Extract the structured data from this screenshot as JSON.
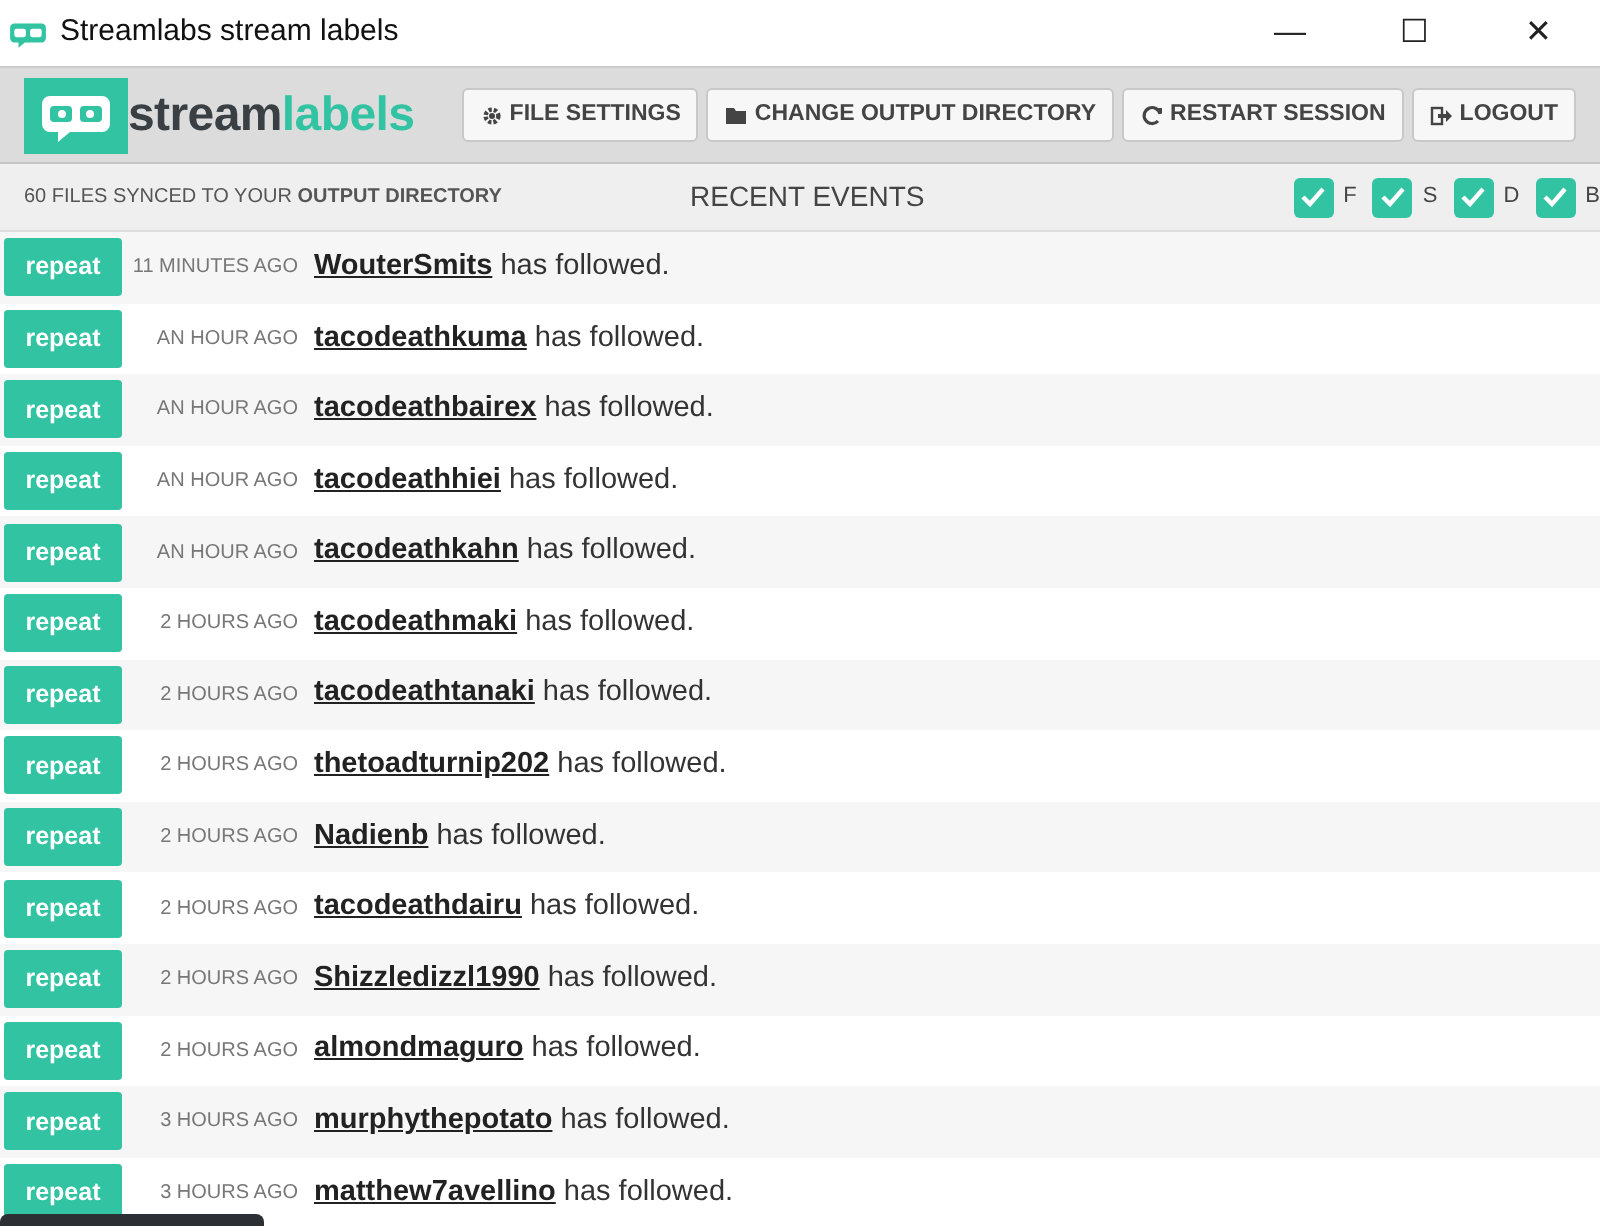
{
  "window": {
    "title": "Streamlabs stream labels",
    "controls": [
      "—",
      "☐",
      "✕"
    ]
  },
  "logo": {
    "part_1": "stream",
    "part_2": "labels"
  },
  "toolbar": [
    {
      "kind": "gear",
      "label": "FILE SETTINGS"
    },
    {
      "kind": "folder",
      "label": "CHANGE OUTPUT DIRECTORY"
    },
    {
      "kind": "refresh",
      "label": "RESTART SESSION"
    },
    {
      "kind": "logout",
      "label": "LOGOUT"
    }
  ],
  "sync_status": "60 FILES SYNCED TO YOUR **OUTPUT DIRECTORY**",
  "section_title": "RECENT EVENTS",
  "filters": [
    {
      "label": "F",
      "checked": true
    },
    {
      "label": "S",
      "checked": true
    },
    {
      "label": "D",
      "checked": true
    },
    {
      "label": "B",
      "checked": true
    }
  ],
  "events": [
    {
      "button": "repeat",
      "time": "11 MINUTES AGO",
      "user": "WouterSmits",
      "action": "has followed."
    },
    {
      "button": "repeat",
      "time": "AN HOUR AGO",
      "user": "tacodeathkuma",
      "action": "has followed."
    },
    {
      "button": "repeat",
      "time": "AN HOUR AGO",
      "user": "tacodeathbairex",
      "action": "has followed."
    },
    {
      "button": "repeat",
      "time": "AN HOUR AGO",
      "user": "tacodeathhiei",
      "action": "has followed."
    },
    {
      "button": "repeat",
      "time": "AN HOUR AGO",
      "user": "tacodeathkahn",
      "action": "has followed."
    },
    {
      "button": "repeat",
      "time": "2 HOURS AGO",
      "user": "tacodeathmaki",
      "action": "has followed."
    },
    {
      "button": "repeat",
      "time": "2 HOURS AGO",
      "user": "tacodeathtanaki",
      "action": "has followed."
    },
    {
      "button": "repeat",
      "time": "2 HOURS AGO",
      "user": "thetoadturnip202",
      "action": "has followed."
    },
    {
      "button": "repeat",
      "time": "2 HOURS AGO",
      "user": "Nadienb",
      "action": "has followed."
    },
    {
      "button": "repeat",
      "time": "2 HOURS AGO",
      "user": "tacodeathdairu",
      "action": "has followed."
    },
    {
      "button": "repeat",
      "time": "2 HOURS AGO",
      "user": "Shizzledizzl1990",
      "action": "has followed."
    },
    {
      "button": "repeat",
      "time": "2 HOURS AGO",
      "user": "almondmaguro",
      "action": "has followed."
    },
    {
      "button": "repeat",
      "time": "3 HOURS AGO",
      "user": "murphythepotato",
      "action": "has followed."
    },
    {
      "button": "repeat",
      "time": "3 HOURS AGO",
      "user": "matthew7avellino",
      "action": "has followed."
    }
  ]
}
